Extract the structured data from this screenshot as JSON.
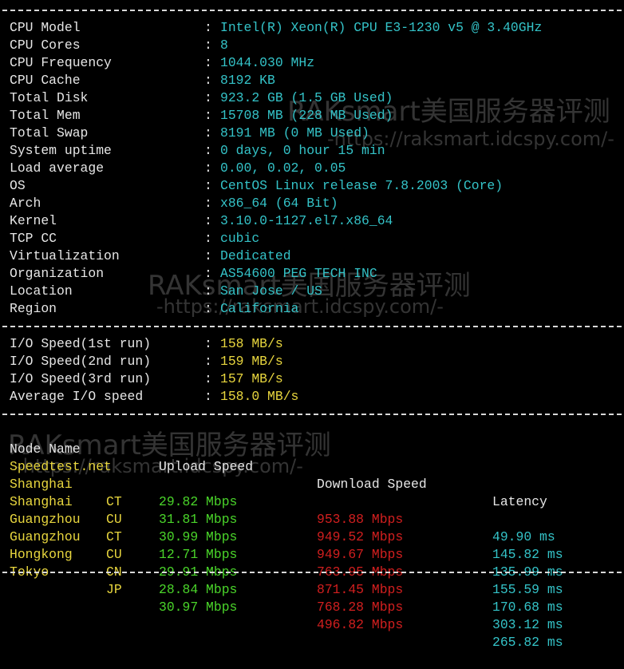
{
  "system_info": [
    {
      "label": "CPU Model",
      "value": "Intel(R) Xeon(R) CPU E3-1230 v5 @ 3.40GHz"
    },
    {
      "label": "CPU Cores",
      "value": "8"
    },
    {
      "label": "CPU Frequency",
      "value": "1044.030 MHz"
    },
    {
      "label": "CPU Cache",
      "value": "8192 KB"
    },
    {
      "label": "Total Disk",
      "value": "923.2 GB (1.5 GB Used)"
    },
    {
      "label": "Total Mem",
      "value": "15708 MB (228 MB Used)"
    },
    {
      "label": "Total Swap",
      "value": "8191 MB (0 MB Used)"
    },
    {
      "label": "System uptime",
      "value": "0 days, 0 hour 15 min"
    },
    {
      "label": "Load average",
      "value": "0.00, 0.02, 0.05"
    },
    {
      "label": "OS",
      "value": "CentOS Linux release 7.8.2003 (Core)"
    },
    {
      "label": "Arch",
      "value": "x86_64 (64 Bit)"
    },
    {
      "label": "Kernel",
      "value": "3.10.0-1127.el7.x86_64"
    },
    {
      "label": "TCP CC",
      "value": "cubic"
    },
    {
      "label": "Virtualization",
      "value": "Dedicated"
    },
    {
      "label": "Organization",
      "value": "AS54600 PEG TECH INC"
    },
    {
      "label": "Location",
      "value": "San Jose / US"
    },
    {
      "label": "Region",
      "value": "California"
    }
  ],
  "io_info": [
    {
      "label": "I/O Speed(1st run)",
      "value": "158 MB/s"
    },
    {
      "label": "I/O Speed(2nd run)",
      "value": "159 MB/s"
    },
    {
      "label": "I/O Speed(3rd run)",
      "value": "157 MB/s"
    },
    {
      "label": "Average I/O speed",
      "value": "158.0 MB/s"
    }
  ],
  "speed_header": {
    "node": "Node Name",
    "upload": "Upload Speed",
    "download": "Download Speed",
    "latency": "Latency"
  },
  "speed_rows": [
    {
      "node": "Speedtest.net",
      "code": "",
      "upload": "29.82 Mbps",
      "download": "953.88 Mbps",
      "latency": "49.90 ms"
    },
    {
      "node": "Shanghai",
      "code": "CT",
      "upload": "31.81 Mbps",
      "download": "949.52 Mbps",
      "latency": "145.82 ms"
    },
    {
      "node": "Shanghai",
      "code": "CU",
      "upload": "30.99 Mbps",
      "download": "949.67 Mbps",
      "latency": "135.99 ms"
    },
    {
      "node": "Guangzhou",
      "code": "CT",
      "upload": "12.71 Mbps",
      "download": "763.95 Mbps",
      "latency": "155.59 ms"
    },
    {
      "node": "Guangzhou",
      "code": "CU",
      "upload": "29.91 Mbps",
      "download": "871.45 Mbps",
      "latency": "170.68 ms"
    },
    {
      "node": "Hongkong",
      "code": "CN",
      "upload": "28.84 Mbps",
      "download": "768.28 Mbps",
      "latency": "303.12 ms"
    },
    {
      "node": "Tokyo",
      "code": "JP",
      "upload": "30.97 Mbps",
      "download": "496.82 Mbps",
      "latency": "265.82 ms"
    }
  ],
  "colon": ":",
  "watermarks": {
    "brand": "RAKsmart美国服务器评测",
    "url": "-https://raksmart.idcspy.com/-"
  },
  "colors": {
    "background": "#000000",
    "label": "#e6e6e6",
    "value": "#34c3c8",
    "io_value": "#e8d63e",
    "node": "#e8d63e",
    "upload": "#4ad52a",
    "download": "#d21f1f"
  }
}
